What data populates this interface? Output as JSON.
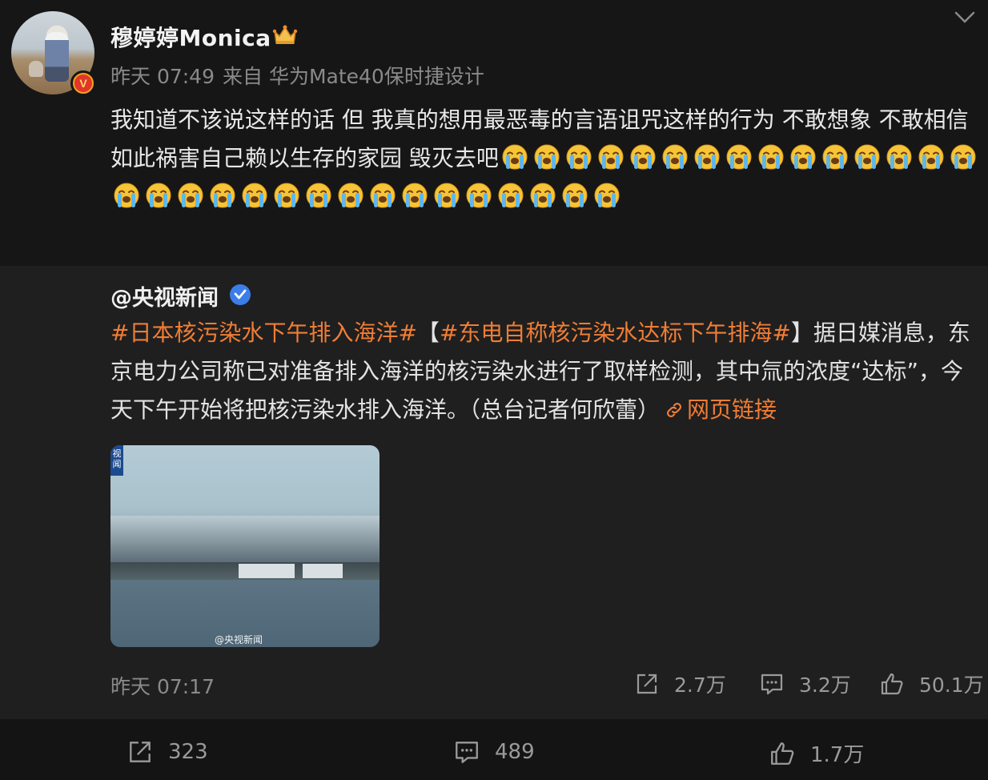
{
  "post": {
    "username": "穆婷婷Monica",
    "time": "昨天 07:49",
    "source": "来自 华为Mate40保时捷设计",
    "badge": "V",
    "text": "我知道不该说这样的话 但 我真的想用最恶毒的言语诅咒这样的行为 不敢想象 不敢相信 如此祸害自己赖以生存的家园 毁灭去吧",
    "emoji_name": "crying-face",
    "emoji_count": 31
  },
  "repost": {
    "author": "@央视新闻",
    "topic1": "#日本核污染水下午排入海洋#",
    "topic2_open": "【",
    "topic2": "#东电自称核污染水达标下午排海#",
    "topic2_close": "】",
    "body": "据日媒消息，东京电力公司称已对准备排入海洋的核污染水进行了取样检测，其中氚的浓度“达标”，今天下午开始将把核污染水排入海洋。（总台记者何欣蕾）",
    "link_label": "网页链接",
    "thumb_tag": "视闻",
    "thumb_watermark": "@央视新闻",
    "time": "昨天 07:17",
    "shares": "2.7万",
    "comments": "3.2万",
    "likes": "50.1万"
  },
  "actions": {
    "shares": "323",
    "comments": "489",
    "likes": "1.7万"
  },
  "colors": {
    "accent": "#f07d35",
    "bg": "#161616",
    "repost_bg": "#1f1f1f",
    "verified_blue": "#3b7ee8"
  }
}
